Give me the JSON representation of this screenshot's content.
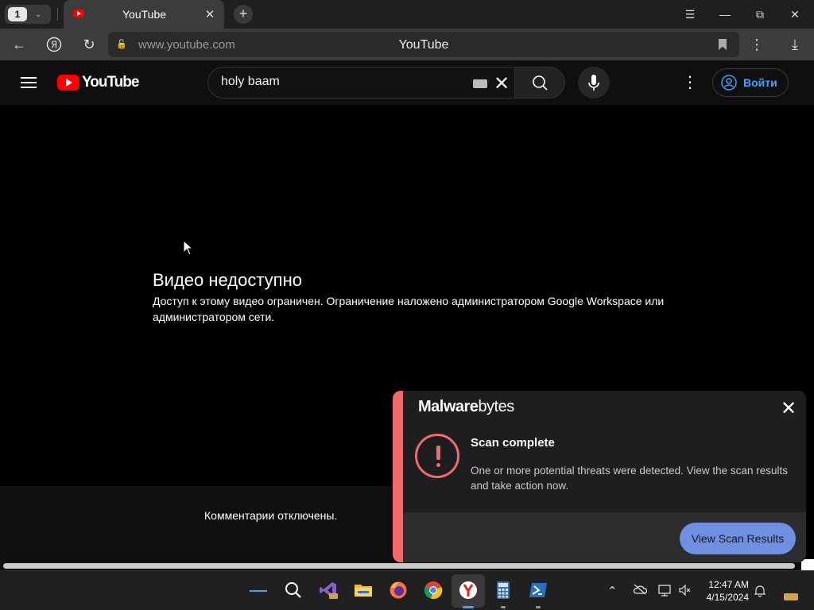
{
  "browser": {
    "tab_count": "1",
    "tab_title": "YouTube",
    "url": "www.youtube.com",
    "page_title": "YouTube"
  },
  "youtube": {
    "logo_text": "YouTube",
    "search_query": "holy baam",
    "signin_label": "Войти"
  },
  "player": {
    "error_title": "Видео недоступно",
    "error_message": "Доступ к этому видео ограничен. Ограничение наложено администратором Google Workspace или администратором сети."
  },
  "comments": {
    "status": "Комментарии отключены."
  },
  "toast": {
    "brand_bold": "Malware",
    "brand_light": "bytes",
    "title": "Scan complete",
    "body": "One or more potential threats were detected. View the scan results and take action now.",
    "action_label": "View Scan Results",
    "accent_color": "#f06a6a",
    "button_color": "#6f8fe0"
  },
  "taskbar": {
    "time": "12:47 AM",
    "date": "4/15/2024",
    "icons": [
      "search-icon",
      "visual-studio-icon",
      "file-explorer-icon",
      "firefox-icon",
      "chrome-icon",
      "yandex-browser-icon",
      "calculator-icon",
      "powershell-icon"
    ],
    "tray_icons": [
      "chevron-up-icon",
      "onedrive-off-icon",
      "network-icon",
      "volume-muted-icon",
      "notification-bell-icon"
    ]
  }
}
